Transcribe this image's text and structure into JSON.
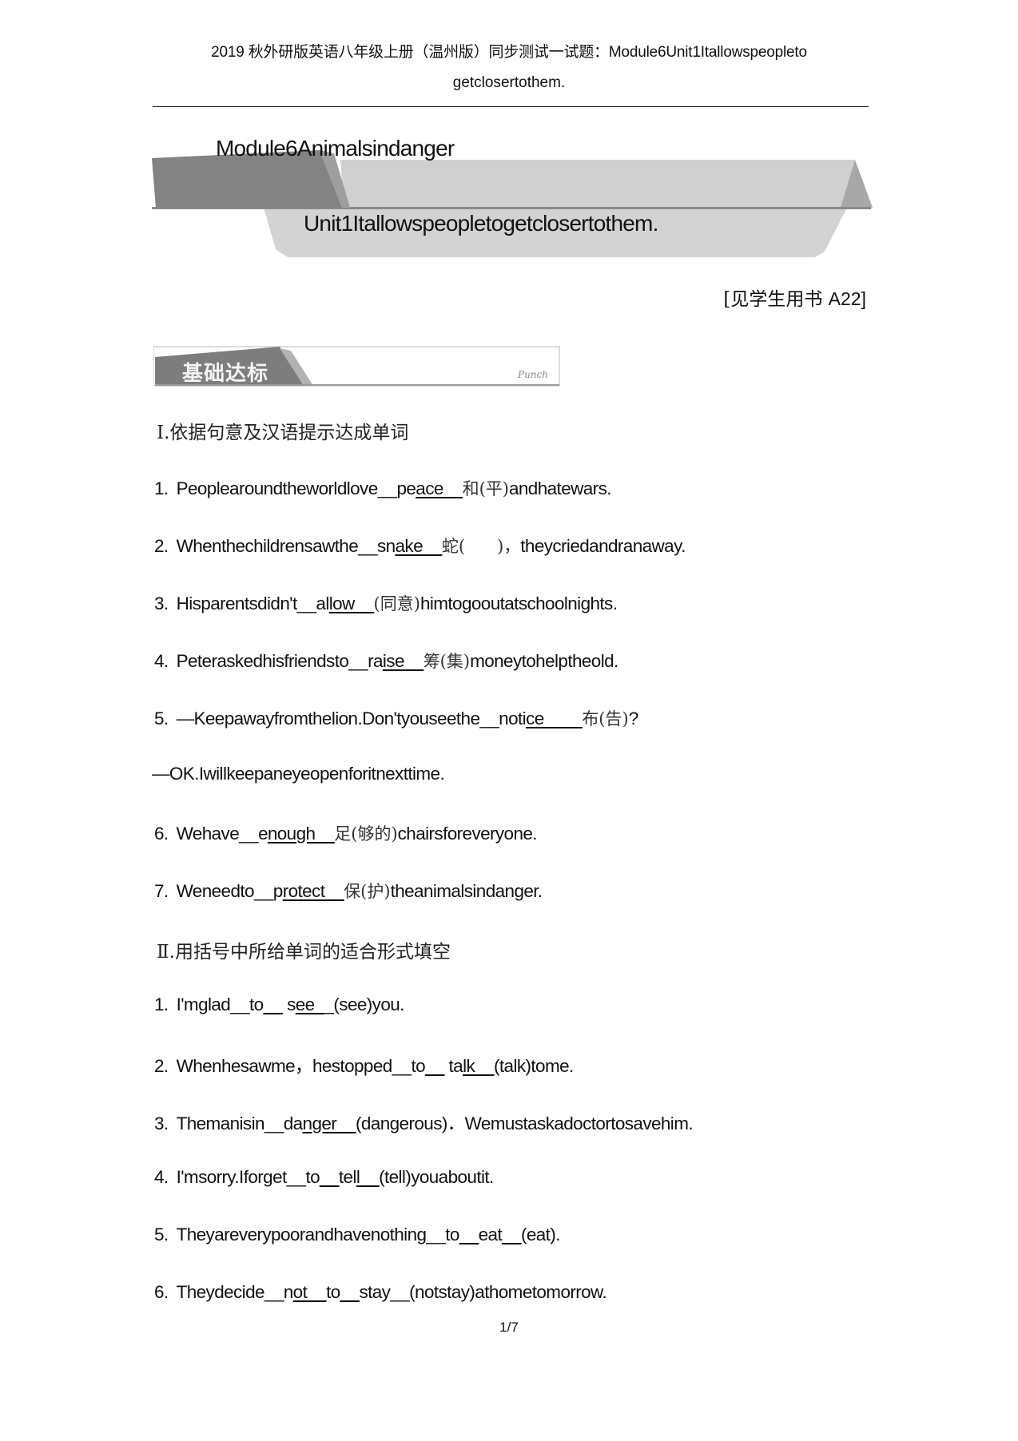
{
  "header": {
    "line1": "2019 秋外研版英语八年级上册（温州版）同步测试一试题：Module6Unit1Itallowspeopleto",
    "line2": "getclosertothem."
  },
  "banner": {
    "module_title": "Module6Animalsindanger",
    "unit_title": "Unit1Itallowspeopletogetclosertothem."
  },
  "reference": {
    "cn": "[见学生用书 ",
    "code": "A22]"
  },
  "section_badge": {
    "title": "基础达标",
    "subtitle": "Punch"
  },
  "sections": [
    {
      "heading": "Ⅰ.依据句意及汉语提示达成单词",
      "questions": [
        {
          "num": "1.",
          "pre": "Peoplearoundtheworldlove__pe",
          "ans": "ace__",
          "cn": "和(平)",
          "post": "andhatewars."
        },
        {
          "num": "2.",
          "pre": "Whenthechildrensawthe__sn",
          "ans": "ake__",
          "cn": "蛇(      )，",
          "post": "theycriedandranaway."
        },
        {
          "num": "3.",
          "pre": "Hisparentsdidn't__al",
          "ans": "low__",
          "cn": "(同意)",
          "post": "himtogooutatschoolnights."
        },
        {
          "num": "4.",
          "pre": "Peteraskedhisfriendsto__ra",
          "ans": "ise__",
          "cn": "筹(集)",
          "post": "moneytohelptheold."
        },
        {
          "num": "5.",
          "pre": "—Keepawayfromthelion.Don'tyouseethe__noti",
          "ans": "ce____",
          "cn": "布(告)",
          "post": "?"
        },
        {
          "num": "",
          "pre": "—OK.Iwillkeepaneyeopenforitnexttime.",
          "ans": "",
          "cn": "",
          "post": ""
        },
        {
          "num": "6.",
          "pre": "Wehave__e",
          "ans": "nough__",
          "cn": "足(够的)",
          "post": "chairsforeveryone."
        },
        {
          "num": "7.",
          "pre": "Weneedto__p",
          "ans": "rotect__",
          "cn": "保(护)",
          "post": "theanimalsindanger."
        }
      ]
    },
    {
      "heading": "Ⅱ.用括号中所给单词的适合形式填空",
      "questions": [
        {
          "num": "1.",
          "pre": "I'mglad__to",
          "ans": "__",
          "mid": " s",
          "ans2": "ee_",
          "post": "_(see)you."
        },
        {
          "num": "2.",
          "pre": "Whenhesawme，hestopped__to",
          "ans": "__",
          "mid": " ta",
          "ans2": "lk__",
          "post": "(talk)tome."
        },
        {
          "num": "3.",
          "pre": "Themanisin__da",
          "ans": "nger__",
          "mid": "",
          "ans2": "",
          "post": "(dangerous)．Wemustaskadoctortosavehim."
        },
        {
          "num": "4.",
          "pre": "I'msorry.Iforget__to",
          "ans": "__",
          "mid": "tel",
          "ans2": "l__",
          "post": "(tell)youaboutit."
        },
        {
          "num": "5.",
          "pre": "Theyareverypoorandhavenothing__to",
          "ans": "__",
          "mid": "eat",
          "ans2": "__",
          "post": "(eat)."
        },
        {
          "num": "6.",
          "pre": "Theydecide__n",
          "ans": "ot__",
          "mid": "to",
          "ans2": "__",
          "post": "stay__(notstay)athometomorrow."
        }
      ]
    }
  ],
  "footer": {
    "page": "1/7"
  }
}
